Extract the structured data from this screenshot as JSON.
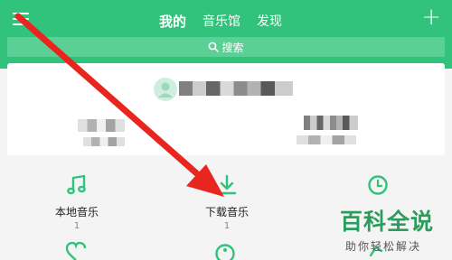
{
  "header": {
    "tabs": [
      "我的",
      "音乐馆",
      "发现"
    ],
    "active_tab": "我的"
  },
  "search": {
    "placeholder": "搜索"
  },
  "menu": [
    {
      "label": "本地音乐",
      "count": "1",
      "icon": "music-note-icon"
    },
    {
      "label": "下载音乐",
      "count": "1",
      "icon": "download-icon"
    },
    {
      "label": "",
      "count": "",
      "icon": "clock-icon"
    }
  ],
  "watermark": {
    "title": "百科全说",
    "subtitle": "助你轻松解决"
  },
  "colors": {
    "brand": "#31c27c",
    "annotation_arrow": "#e8261f"
  }
}
